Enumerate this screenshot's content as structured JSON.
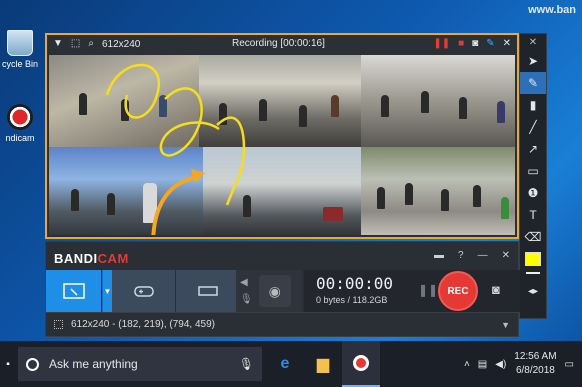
{
  "desktop": {
    "watermark": "www.ban",
    "icons": [
      {
        "label": "cycle Bin",
        "icon": "recycle-bin-icon"
      },
      {
        "label": "ndicam",
        "icon": "bandicam-icon"
      }
    ]
  },
  "capture_window": {
    "size_label": "612x240",
    "status": "Recording [00:00:16]",
    "accent_color": "#f5a623"
  },
  "draw_toolbar": {
    "tools": [
      "cursor-icon",
      "pen-icon",
      "highlighter-icon",
      "line-icon",
      "arrow-icon",
      "rectangle-icon",
      "numbering-icon",
      "text-icon",
      "eraser-icon"
    ],
    "active_tool": "pen-icon",
    "color": "#ffff00"
  },
  "bandicam": {
    "logo_bandi": "BANDI",
    "logo_cam": "CAM",
    "timer": "00:00:00",
    "bytes": "0 bytes / 118.2GB",
    "rec_label": "REC",
    "status_text": "612x240 - (182, 219), (794, 459)"
  },
  "taskbar": {
    "search_placeholder": "Ask me anything",
    "time": "12:56 AM",
    "date": "6/8/2018"
  }
}
